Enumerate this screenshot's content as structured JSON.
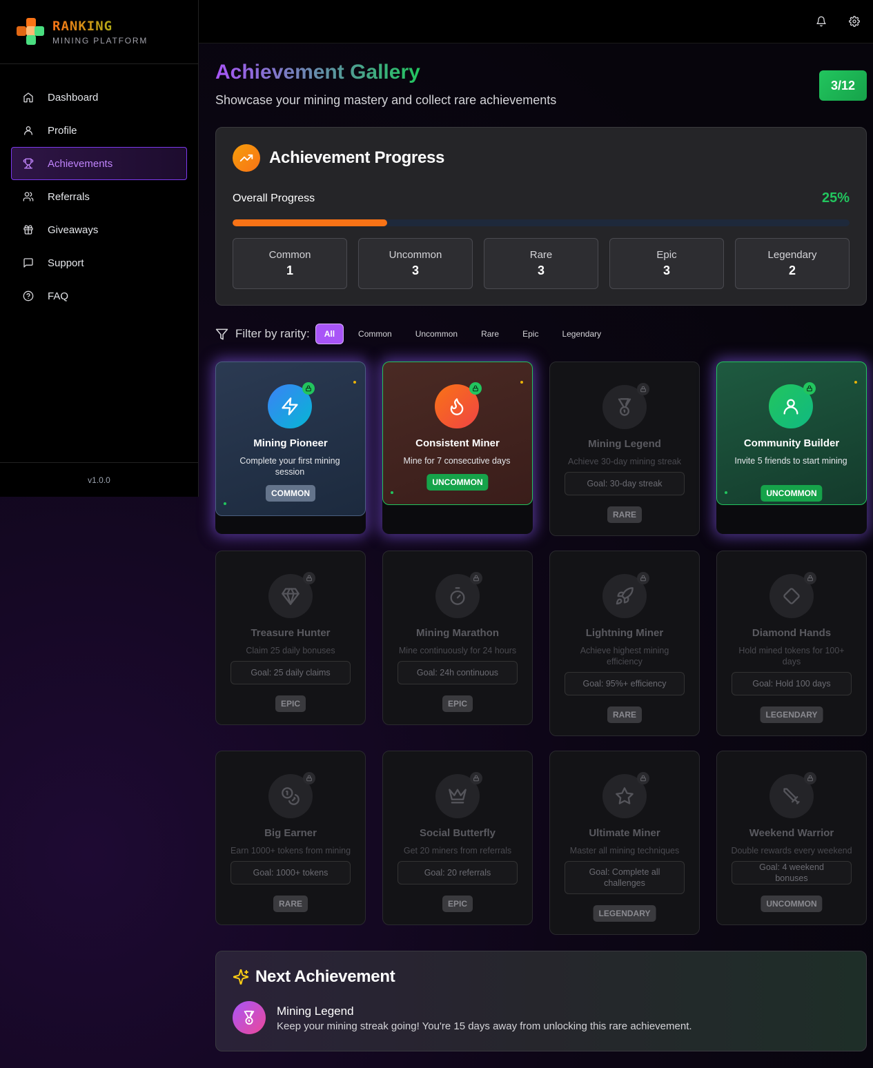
{
  "brand": {
    "name": "RANKING",
    "subtitle": "MINING PLATFORM"
  },
  "sidebar": {
    "items": [
      {
        "label": "Dashboard",
        "icon": "home-icon"
      },
      {
        "label": "Profile",
        "icon": "user-icon"
      },
      {
        "label": "Achievements",
        "icon": "trophy-icon",
        "active": true
      },
      {
        "label": "Referrals",
        "icon": "users-icon"
      },
      {
        "label": "Giveaways",
        "icon": "gift-icon"
      },
      {
        "label": "Support",
        "icon": "message-icon"
      },
      {
        "label": "FAQ",
        "icon": "help-icon"
      }
    ],
    "version": "v1.0.0"
  },
  "header": {
    "title": "Achievement Gallery",
    "subtitle": "Showcase your mining mastery and collect rare achievements",
    "count": "3/12"
  },
  "progress": {
    "title": "Achievement Progress",
    "label": "Overall Progress",
    "percent_text": "25%",
    "fraction": 0.25,
    "stats": [
      {
        "label": "Common",
        "value": "1"
      },
      {
        "label": "Uncommon",
        "value": "3"
      },
      {
        "label": "Rare",
        "value": "3"
      },
      {
        "label": "Epic",
        "value": "3"
      },
      {
        "label": "Legendary",
        "value": "2"
      }
    ]
  },
  "filter": {
    "label": "Filter by rarity:",
    "options": [
      "All",
      "Common",
      "Uncommon",
      "Rare",
      "Epic",
      "Legendary"
    ],
    "selected": "All"
  },
  "achievements": [
    {
      "name": "Mining Pioneer",
      "desc": "Complete your first mining session",
      "rarity": "COMMON",
      "unlocked": true,
      "icon": "zap-icon"
    },
    {
      "name": "Consistent Miner",
      "desc": "Mine for 7 consecutive days",
      "rarity": "UNCOMMON",
      "unlocked": true,
      "icon": "flame-icon"
    },
    {
      "name": "Mining Legend",
      "desc": "Achieve 30-day mining streak",
      "goal": "Goal: 30-day streak",
      "rarity": "RARE",
      "unlocked": false,
      "icon": "medal-icon"
    },
    {
      "name": "Community Builder",
      "desc": "Invite 5 friends to start mining",
      "rarity": "UNCOMMON",
      "unlocked": true,
      "icon": "user-icon"
    },
    {
      "name": "Treasure Hunter",
      "desc": "Claim 25 daily bonuses",
      "goal": "Goal: 25 daily claims",
      "rarity": "EPIC",
      "unlocked": false,
      "icon": "gem-icon"
    },
    {
      "name": "Mining Marathon",
      "desc": "Mine continuously for 24 hours",
      "goal": "Goal: 24h continuous",
      "rarity": "EPIC",
      "unlocked": false,
      "icon": "timer-icon"
    },
    {
      "name": "Lightning Miner",
      "desc": "Achieve highest mining efficiency",
      "goal": "Goal: 95%+ efficiency",
      "rarity": "RARE",
      "unlocked": false,
      "icon": "rocket-icon"
    },
    {
      "name": "Diamond Hands",
      "desc": "Hold mined tokens for 100+ days",
      "goal": "Goal: Hold 100 days",
      "rarity": "LEGENDARY",
      "unlocked": false,
      "icon": "diamond-icon"
    },
    {
      "name": "Big Earner",
      "desc": "Earn 1000+ tokens from mining",
      "goal": "Goal: 1000+ tokens",
      "rarity": "RARE",
      "unlocked": false,
      "icon": "coins-icon"
    },
    {
      "name": "Social Butterfly",
      "desc": "Get 20 miners from referrals",
      "goal": "Goal: 20 referrals",
      "rarity": "EPIC",
      "unlocked": false,
      "icon": "crown-icon"
    },
    {
      "name": "Ultimate Miner",
      "desc": "Master all mining techniques",
      "goal": "Goal: Complete all challenges",
      "rarity": "LEGENDARY",
      "unlocked": false,
      "icon": "star-icon"
    },
    {
      "name": "Weekend Warrior",
      "desc": "Double rewards every weekend",
      "goal": "Goal: 4 weekend bonuses",
      "rarity": "UNCOMMON",
      "unlocked": false,
      "icon": "sword-icon"
    }
  ],
  "next": {
    "title": "Next Achievement",
    "name": "Mining Legend",
    "desc": "Keep your mining streak going! You're 15 days away from unlocking this rare achievement."
  },
  "colors": {
    "accent": "#a855f7",
    "success": "#22c55e",
    "progress": "#f97316",
    "common": "#64748b",
    "uncommon": "#16a34a"
  }
}
